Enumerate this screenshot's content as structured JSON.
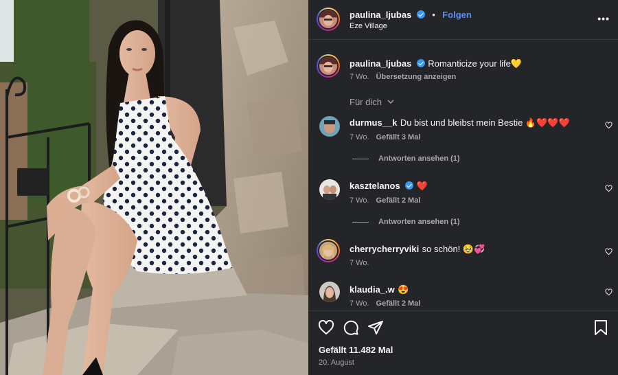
{
  "header": {
    "username": "paulina_ljubas",
    "follow_label": "Folgen",
    "location": "Eze Village"
  },
  "caption": {
    "username": "paulina_ljubas",
    "text": "Romanticize your life💛",
    "time": "7 Wo.",
    "translate_label": "Übersetzung anzeigen"
  },
  "sort_label": "Für dich",
  "comments": [
    {
      "username": "durmus__k",
      "text": "Du bist und bleibst mein Bestie 🔥❤️❤️❤️",
      "time": "7 Wo.",
      "likes": "Gefällt 3 Mal",
      "replies": "Antworten ansehen (1)"
    },
    {
      "username": "kasztelanos",
      "text": "❤️",
      "time": "7 Wo.",
      "likes": "Gefällt 2 Mal",
      "replies": "Antworten ansehen (1)"
    },
    {
      "username": "cherrycherryviki",
      "text": "so schön! 🥹💞",
      "time": "7 Wo."
    },
    {
      "username": "klaudia_.w",
      "text": "😍",
      "time": "7 Wo.",
      "likes": "Gefällt 2 Mal"
    }
  ],
  "footer": {
    "likes": "Gefällt 11.482 Mal",
    "date": "20. August"
  },
  "icons": [
    "more-options-icon",
    "verified-icon",
    "heart-icon",
    "comment-icon",
    "share-icon",
    "bookmark-icon",
    "chevron-down-icon"
  ],
  "colors": {
    "panel_bg": "#232529",
    "follow": "#5b8cf7",
    "verified": "#3897f0",
    "muted": "#a8a8a8"
  }
}
